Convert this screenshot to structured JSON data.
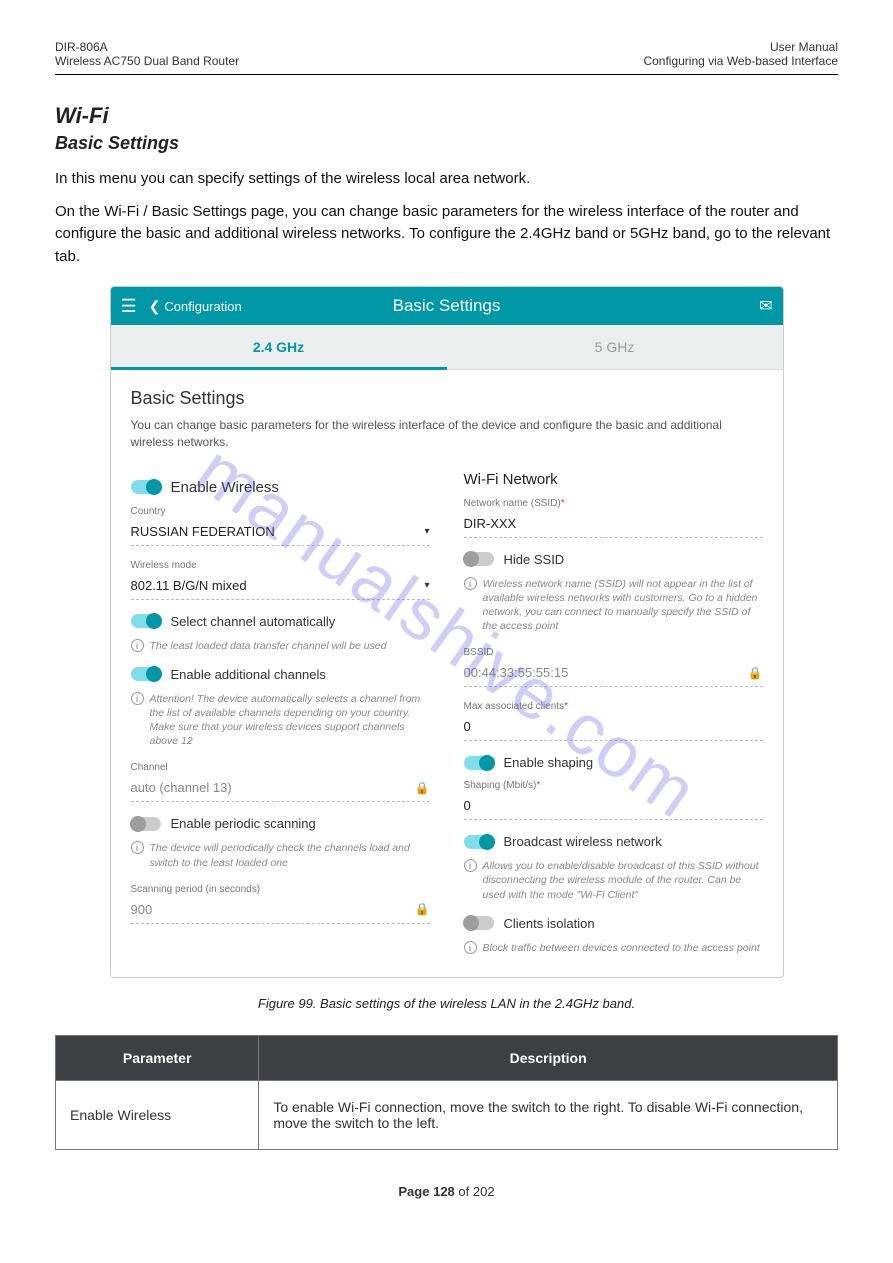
{
  "doc": {
    "header_left_line1": "DIR-806A",
    "header_left_line2": "Wireless AC750 Dual Band Router",
    "header_right_line1": "User Manual",
    "header_right_line2": "Configuring via Web-based Interface",
    "section_title": "Wi-Fi",
    "section_sub": "Basic Settings",
    "section_body_1": "In this menu you can specify settings of the wireless local area network.",
    "section_body_2": "On the Wi-Fi / Basic Settings page, you can change basic parameters for the wireless interface of the router and configure the basic and additional wireless networks. To configure the 2.4GHz band or 5GHz band, go to the relevant tab.",
    "figure_caption": "Figure 99. Basic settings of the wireless LAN in the 2.4GHz band.",
    "page_no_label": "Page",
    "page_current": "128",
    "page_of": "of",
    "page_total": "202"
  },
  "ui": {
    "topbar": {
      "back_label": "Configuration",
      "title": "Basic Settings"
    },
    "tabs": {
      "t0": "2.4 GHz",
      "t1": "5 GHz"
    },
    "content_title": "Basic Settings",
    "content_desc": "You can change basic parameters for the wireless interface of the device and configure the basic and additional wireless networks.",
    "left": {
      "enable_wireless": "Enable Wireless",
      "country_label": "Country",
      "country_value": "RUSSIAN FEDERATION",
      "mode_label": "Wireless mode",
      "mode_value": "802.11 B/G/N mixed",
      "select_auto": "Select channel automatically",
      "auto_info": "The least loaded data transfer channel will be used",
      "enable_addl": "Enable additional channels",
      "addl_warn": "Attention! The device automatically selects a channel from the list of available channels depending on your country. Make sure that your wireless devices support channels above 12",
      "channel_label": "Channel",
      "channel_value": "auto (channel 13)",
      "periodic": "Enable periodic scanning",
      "periodic_info": "The device will periodically check the channels load and switch to the least loaded one",
      "scan_period_label": "Scanning period (in seconds)",
      "scan_period_value": "900"
    },
    "right": {
      "section": "Wi-Fi Network",
      "ssid_label": "Network name (SSID)",
      "ssid_value": "DIR-XXX",
      "hide_ssid": "Hide SSID",
      "hide_info": "Wireless network name (SSID) will not appear in the list of available wireless networks with customers. Go to a hidden network, you can connect to manually specify the SSID of the access point",
      "bssid_label": "BSSID",
      "bssid_value": "00:44:33:55:55:15",
      "max_clients_label": "Max associated clients",
      "max_clients_value": "0",
      "enable_shaping": "Enable shaping",
      "shaping_label": "Shaping (Mbit/s)",
      "shaping_value": "0",
      "broadcast": "Broadcast wireless network",
      "broadcast_info": "Allows you to enable/disable broadcast of this SSID without disconnecting the wireless module of the router. Can be used with the mode \"Wi-Fi Client\"",
      "clients_iso": "Clients isolation",
      "clients_iso_info": "Block traffic between devices connected to the access point"
    }
  },
  "table": {
    "h0": "Parameter",
    "h1": "Description",
    "row0": {
      "param": "Enable Wireless",
      "desc": "To enable Wi-Fi connection, move the switch to the right. To disable Wi-Fi connection, move the switch to the left."
    }
  },
  "watermark": "manualshive.com"
}
